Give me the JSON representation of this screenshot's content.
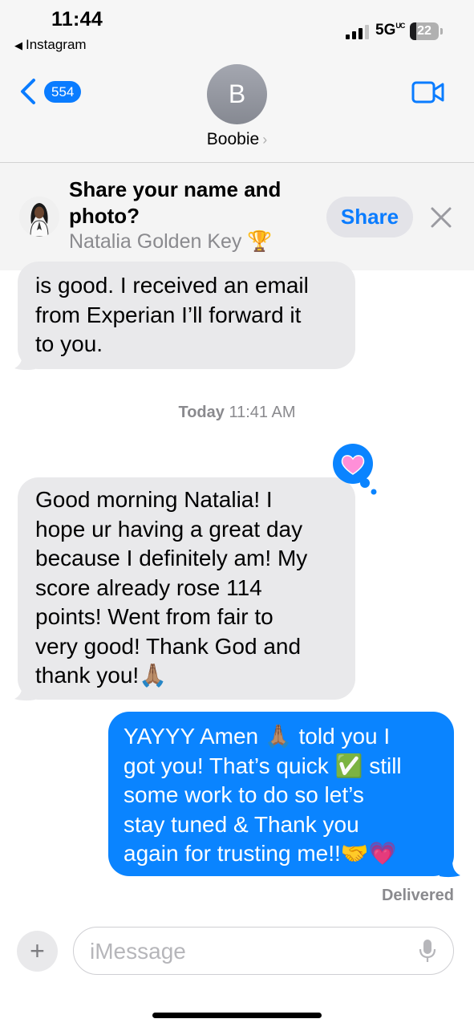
{
  "status_bar": {
    "time": "11:44",
    "back_app": "Instagram",
    "network": "5G",
    "network_suffix": "UC",
    "battery": "22",
    "battery_level": 0.22,
    "signal_bars": 3
  },
  "header": {
    "back_badge": "554",
    "avatar_initial": "B",
    "contact_name": "Boobie"
  },
  "share_banner": {
    "title": "Share your name and photo?",
    "subtitle": "Natalia Golden Key 🏆",
    "share_label": "Share"
  },
  "messages": [
    {
      "direction": "incoming",
      "text": "is good. I received an email\nfrom Experian I’ll forward it\nto you."
    },
    {
      "direction": "incoming",
      "text": "Good morning Natalia! I\nhope ur having a great day\nbecause I definitely am! My\nscore already rose 114\npoints!  Went from fair to\nvery good! Thank God and\nthank you!🙏🏽",
      "tapback": "heart"
    },
    {
      "direction": "outgoing",
      "text": "YAYYY Amen 🙏🏽 told you I\ngot you! That’s quick ✅ still\nsome work to do so let’s\nstay tuned & Thank you\nagain for trusting me!!🤝💗"
    }
  ],
  "timestamp": {
    "day": "Today",
    "time": "11:41 AM"
  },
  "delivered": "Delivered",
  "composer": {
    "placeholder": "iMessage",
    "plus": "+"
  },
  "colors": {
    "imessage_blue": "#0a84ff",
    "incoming_bubble": "#e9e9eb",
    "nav_background": "#f6f6f6",
    "tapback_heart": "#ff8fd8"
  },
  "icons": [
    "chevron-left-icon",
    "video-camera-icon",
    "close-icon",
    "heart-icon",
    "microphone-icon",
    "plus-icon",
    "trophy-icon"
  ]
}
